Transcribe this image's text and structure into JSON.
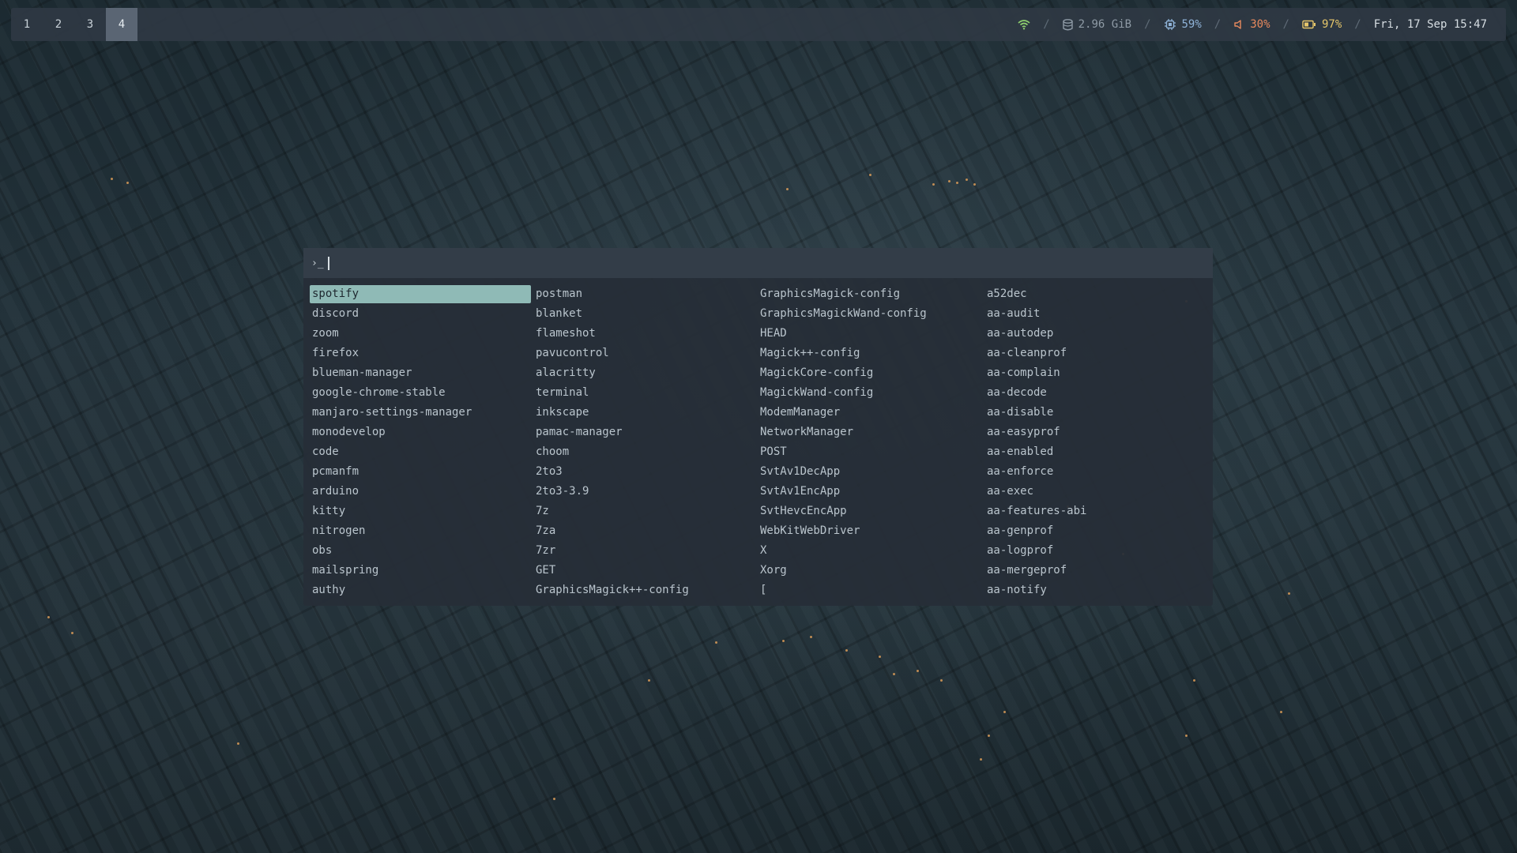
{
  "bar": {
    "workspaces": [
      "1",
      "2",
      "3",
      "4"
    ],
    "active_workspace": "4",
    "separator": "/",
    "memory": {
      "icon": "database-icon",
      "value": "2.96 GiB"
    },
    "cpu": {
      "icon": "cpu-chip-icon",
      "value": "59%"
    },
    "volume": {
      "icon": "speaker-icon",
      "value": "30%"
    },
    "battery": {
      "icon": "battery-icon",
      "value": "97%"
    },
    "wifi": {
      "icon": "wifi-icon"
    },
    "clock": "Fri, 17 Sep 15:47",
    "colors": {
      "wifi": "#8fd16f",
      "memory": "#8e9aa5",
      "cpu": "#8fb3d8",
      "volume": "#e88a5e",
      "battery": "#e6c66a"
    }
  },
  "launcher": {
    "prompt_symbol": "›_",
    "query": "",
    "selected": "spotify",
    "selection_color": "#8fbab6",
    "items": [
      "spotify",
      "discord",
      "zoom",
      "firefox",
      "blueman-manager",
      "google-chrome-stable",
      "manjaro-settings-manager",
      "monodevelop",
      "code",
      "pcmanfm",
      "arduino",
      "kitty",
      "nitrogen",
      "obs",
      "mailspring",
      "authy",
      "postman",
      "blanket",
      "flameshot",
      "pavucontrol",
      "alacritty",
      "terminal",
      "inkscape",
      "pamac-manager",
      "choom",
      "2to3",
      "2to3-3.9",
      "7z",
      "7za",
      "7zr",
      "GET",
      "GraphicsMagick++-config",
      "GraphicsMagick-config",
      "GraphicsMagickWand-config",
      "HEAD",
      "Magick++-config",
      "MagickCore-config",
      "MagickWand-config",
      "ModemManager",
      "NetworkManager",
      "POST",
      "SvtAv1DecApp",
      "SvtAv1EncApp",
      "SvtHevcEncApp",
      "WebKitWebDriver",
      "X",
      "Xorg",
      "[",
      "a52dec",
      "aa-audit",
      "aa-autodep",
      "aa-cleanprof",
      "aa-complain",
      "aa-decode",
      "aa-disable",
      "aa-easyprof",
      "aa-enabled",
      "aa-enforce",
      "aa-exec",
      "aa-features-abi",
      "aa-genprof",
      "aa-logprof",
      "aa-mergeprof",
      "aa-notify"
    ]
  }
}
